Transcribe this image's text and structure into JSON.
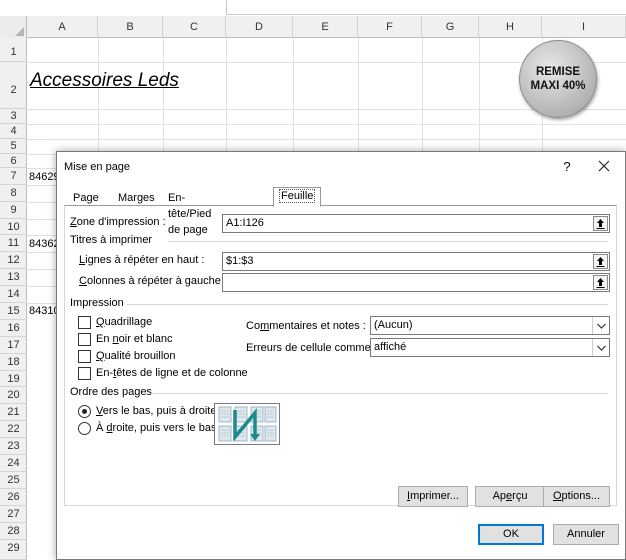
{
  "sheet": {
    "columns": [
      "A",
      "B",
      "C",
      "D",
      "E",
      "F",
      "G",
      "H",
      "I"
    ],
    "rows": [
      "1",
      "2",
      "3",
      "4",
      "5",
      "6",
      "7",
      "8",
      "9",
      "10",
      "11",
      "12",
      "13",
      "14",
      "15",
      "16",
      "17",
      "18",
      "19",
      "20",
      "21",
      "22",
      "23",
      "24",
      "25",
      "26",
      "27",
      "28",
      "29"
    ],
    "title_cell": "Accessoires Leds",
    "partial_cells": [
      "84629",
      "84362",
      "84310"
    ],
    "badge_line1": "REMISE",
    "badge_line2": "MAXI 40%"
  },
  "dialog": {
    "title": "Mise en page",
    "help_label": "?",
    "tabs": [
      {
        "label": "Page",
        "active": false
      },
      {
        "label": "Marges",
        "active": false
      },
      {
        "label": "En-tête/Pied de page",
        "active": false
      },
      {
        "label": "Feuille",
        "active": true
      }
    ],
    "print_area_label_pre": "",
    "print_area_label_ul": "Z",
    "print_area_label_post": "one d'impression :",
    "print_area_value": "A1:I126",
    "print_titles_group": "Titres à imprimer",
    "rows_repeat_label_ul": "L",
    "rows_repeat_label_post": "ignes à répéter en haut :",
    "rows_repeat_value": "$1:$3",
    "cols_repeat_label_ul": "C",
    "cols_repeat_label_post": "olonnes à répéter à gauche :",
    "cols_repeat_value": "",
    "print_group": "Impression",
    "checkboxes": [
      {
        "ul": "Q",
        "rest": "uadrillage",
        "checked": false
      },
      {
        "pre": "En ",
        "ul": "n",
        "rest": "oir et blanc",
        "checked": false
      },
      {
        "ul": "Q",
        "rest": "ualité brouillon",
        "checked": false
      },
      {
        "pre": "En-",
        "ul": "t",
        "rest": "êtes de ligne et de colonne",
        "checked": false
      }
    ],
    "comments_label_pre": "Co",
    "comments_label_ul": "m",
    "comments_label_post": "mentaires et notes :",
    "comments_value": "(Aucun)",
    "errors_label_pre": "Erreurs de cellule comme :",
    "errors_value": "affiché",
    "page_order_group": "Ordre des pages",
    "radio_down_ul": "V",
    "radio_down_rest": "ers le bas, puis à droite",
    "radio_down_selected": true,
    "radio_over_pre": "À ",
    "radio_over_ul": "d",
    "radio_over_rest": "roite, puis vers le bas",
    "radio_over_selected": false,
    "print_button_ul": "I",
    "print_button_rest": "mprimer...",
    "preview_button_pre": "Ap",
    "preview_button_ul": "e",
    "preview_button_rest": "rçu",
    "options_button_ul": "O",
    "options_button_rest": "ptions...",
    "ok_label": "OK",
    "cancel_label": "Annuler"
  },
  "colors": {
    "accent": "#0078d7",
    "badge_gray": "#c6c6c6",
    "page_order_accent": "#1a8a8a"
  }
}
